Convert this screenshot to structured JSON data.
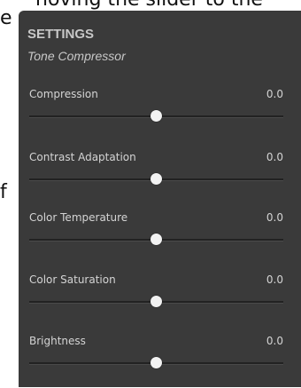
{
  "background_text": {
    "top": "noving the slider to the",
    "left_1": "e",
    "left_2": "f"
  },
  "panel": {
    "title": "SETTINGS",
    "subtitle": "Tone Compressor"
  },
  "sliders": [
    {
      "id": "compression",
      "label": "Compression",
      "value": "0.0",
      "position": 0.5
    },
    {
      "id": "contrast-adaptation",
      "label": "Contrast Adaptation",
      "value": "0.0",
      "position": 0.5
    },
    {
      "id": "color-temperature",
      "label": "Color Temperature",
      "value": "0.0",
      "position": 0.5
    },
    {
      "id": "color-saturation",
      "label": "Color Saturation",
      "value": "0.0",
      "position": 0.5
    },
    {
      "id": "brightness",
      "label": "Brightness",
      "value": "0.0",
      "position": 0.5
    }
  ],
  "colors": {
    "panel_bg": "#3a3a3a",
    "text": "#d4d4d4",
    "thumb": "#f2f2f2"
  }
}
